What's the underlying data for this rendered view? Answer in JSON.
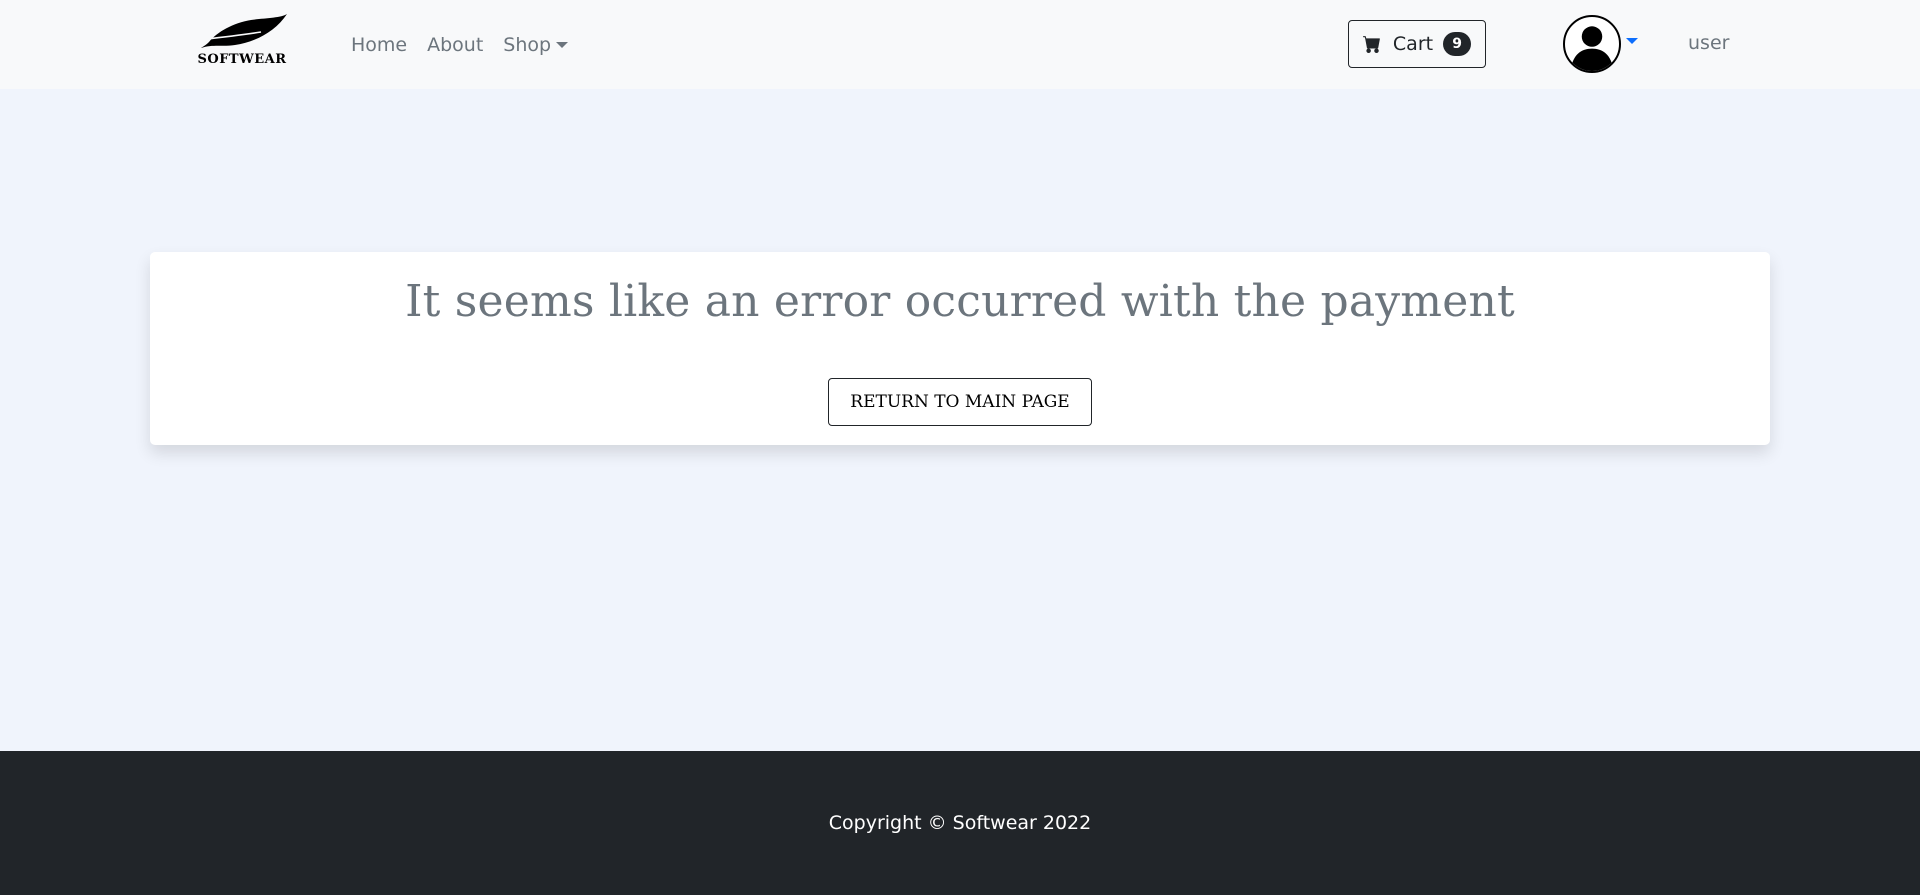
{
  "brand": {
    "name": "SOFTWEAR",
    "icon": "feather-logo-icon"
  },
  "nav": {
    "items": [
      {
        "label": "Home"
      },
      {
        "label": "About"
      },
      {
        "label": "Shop"
      }
    ]
  },
  "cart": {
    "label": "Cart",
    "count": "9",
    "icon": "cart-icon"
  },
  "user": {
    "name": "user",
    "avatar_icon": "user-silhouette-icon"
  },
  "main": {
    "message": "It seems like an error occurred with the payment",
    "return_label": "RETURN TO MAIN PAGE"
  },
  "footer": {
    "copyright": "Copyright © Softwear 2022"
  },
  "colors": {
    "page_bg": "#f0f4fc",
    "navbar_bg": "#f8f9fa",
    "footer_bg": "#212529",
    "muted_text": "#6c757d",
    "accent": "#0d6efd"
  }
}
